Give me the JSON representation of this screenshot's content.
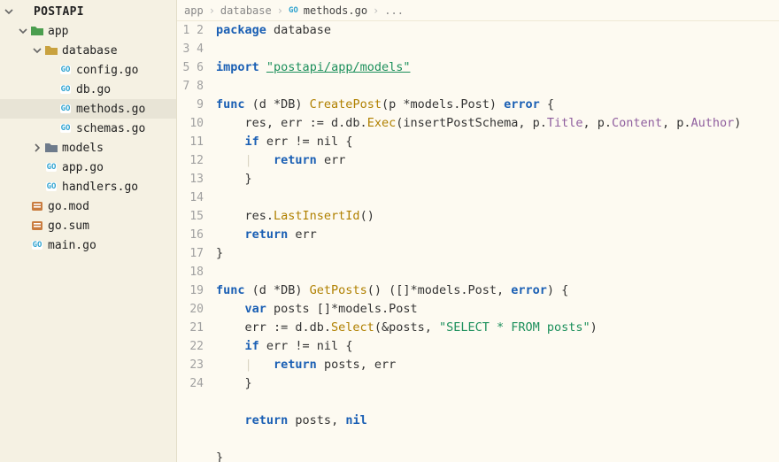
{
  "project": {
    "name": "POSTAPI"
  },
  "tree": [
    {
      "id": "root",
      "label": "POSTAPI",
      "depth": 0,
      "kind": "root",
      "open": true,
      "icon": "chev"
    },
    {
      "id": "app",
      "label": "app",
      "depth": 1,
      "kind": "folder-app",
      "open": true
    },
    {
      "id": "database",
      "label": "database",
      "depth": 2,
      "kind": "folder-pkg",
      "open": true
    },
    {
      "id": "config",
      "label": "config.go",
      "depth": 3,
      "kind": "go"
    },
    {
      "id": "db",
      "label": "db.go",
      "depth": 3,
      "kind": "go"
    },
    {
      "id": "methods",
      "label": "methods.go",
      "depth": 3,
      "kind": "go",
      "selected": true
    },
    {
      "id": "schemas",
      "label": "schemas.go",
      "depth": 3,
      "kind": "go"
    },
    {
      "id": "models",
      "label": "models",
      "depth": 2,
      "kind": "folder-models",
      "open": false
    },
    {
      "id": "appgo",
      "label": "app.go",
      "depth": 2,
      "kind": "go"
    },
    {
      "id": "handlers",
      "label": "handlers.go",
      "depth": 2,
      "kind": "go"
    },
    {
      "id": "gomod",
      "label": "go.mod",
      "depth": 1,
      "kind": "sum"
    },
    {
      "id": "gosum",
      "label": "go.sum",
      "depth": 1,
      "kind": "sum"
    },
    {
      "id": "main",
      "label": "main.go",
      "depth": 1,
      "kind": "go"
    }
  ],
  "breadcrumb": {
    "seg1": "app",
    "seg2": "database",
    "seg3": "methods.go",
    "tail": "..."
  },
  "code": {
    "lines": 24,
    "t": {
      "pkg": "package",
      "db": "database",
      "imp": "import",
      "importPath": "\"postapi/app/models\"",
      "func": "func",
      "recv": "(d *DB)",
      "createPost": "CreatePost",
      "cpArgs": "(p *models.Post)",
      "error": "error",
      "lb": "{",
      "rb": "}",
      "l6a": "res, err := d.db.",
      "exec": "Exec",
      "l6b": "(insertPostSchema, p.",
      "title": "Title",
      "l6c": ", p.",
      "content": "Content",
      "l6d": ", p.",
      "author": "Author",
      "l6e": ")",
      "if": "if",
      "errnil": " err != nil {",
      "retErr": "return",
      "errTok": " err",
      "l11a": "res.",
      "lastInsert": "LastInsertId",
      "l11b": "()",
      "retErr2": "return",
      "errTok2": " err",
      "getPosts": "GetPosts",
      "gpArgs": "() ([]*models.Post, ",
      "gpErr": "error",
      "gpEnd": ") {",
      "var": "var",
      "postsDecl": " posts []*models.Post",
      "l17a": "err := d.db.",
      "select": "Select",
      "l17b": "(&posts, ",
      "selStr": "\"SELECT * FROM posts\"",
      "l17c": ")",
      "retPostsErr": "return",
      "postsErr": " posts, err",
      "retPostsNil": "return",
      "postsNil": " posts, ",
      "nil": "nil"
    }
  }
}
